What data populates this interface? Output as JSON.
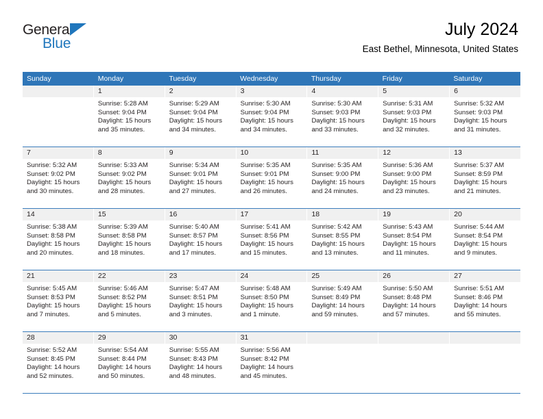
{
  "brand": {
    "name_top": "General",
    "name_bottom": "Blue",
    "accent_color": "#1f76bc"
  },
  "header": {
    "title": "July 2024",
    "subtitle": "East Bethel, Minnesota, United States"
  },
  "theme": {
    "header_row_bg": "#2f76b8",
    "daynum_bg": "#f0f0f0",
    "row_separator": "#3a7cbb"
  },
  "weekdays": [
    "Sunday",
    "Monday",
    "Tuesday",
    "Wednesday",
    "Thursday",
    "Friday",
    "Saturday"
  ],
  "weeks": [
    [
      {
        "day": "",
        "sunrise": "",
        "sunset": "",
        "daylight1": "",
        "daylight2": "",
        "empty": true
      },
      {
        "day": "1",
        "sunrise": "Sunrise: 5:28 AM",
        "sunset": "Sunset: 9:04 PM",
        "daylight1": "Daylight: 15 hours",
        "daylight2": "and 35 minutes."
      },
      {
        "day": "2",
        "sunrise": "Sunrise: 5:29 AM",
        "sunset": "Sunset: 9:04 PM",
        "daylight1": "Daylight: 15 hours",
        "daylight2": "and 34 minutes."
      },
      {
        "day": "3",
        "sunrise": "Sunrise: 5:30 AM",
        "sunset": "Sunset: 9:04 PM",
        "daylight1": "Daylight: 15 hours",
        "daylight2": "and 34 minutes."
      },
      {
        "day": "4",
        "sunrise": "Sunrise: 5:30 AM",
        "sunset": "Sunset: 9:03 PM",
        "daylight1": "Daylight: 15 hours",
        "daylight2": "and 33 minutes."
      },
      {
        "day": "5",
        "sunrise": "Sunrise: 5:31 AM",
        "sunset": "Sunset: 9:03 PM",
        "daylight1": "Daylight: 15 hours",
        "daylight2": "and 32 minutes."
      },
      {
        "day": "6",
        "sunrise": "Sunrise: 5:32 AM",
        "sunset": "Sunset: 9:03 PM",
        "daylight1": "Daylight: 15 hours",
        "daylight2": "and 31 minutes."
      }
    ],
    [
      {
        "day": "7",
        "sunrise": "Sunrise: 5:32 AM",
        "sunset": "Sunset: 9:02 PM",
        "daylight1": "Daylight: 15 hours",
        "daylight2": "and 30 minutes."
      },
      {
        "day": "8",
        "sunrise": "Sunrise: 5:33 AM",
        "sunset": "Sunset: 9:02 PM",
        "daylight1": "Daylight: 15 hours",
        "daylight2": "and 28 minutes."
      },
      {
        "day": "9",
        "sunrise": "Sunrise: 5:34 AM",
        "sunset": "Sunset: 9:01 PM",
        "daylight1": "Daylight: 15 hours",
        "daylight2": "and 27 minutes."
      },
      {
        "day": "10",
        "sunrise": "Sunrise: 5:35 AM",
        "sunset": "Sunset: 9:01 PM",
        "daylight1": "Daylight: 15 hours",
        "daylight2": "and 26 minutes."
      },
      {
        "day": "11",
        "sunrise": "Sunrise: 5:35 AM",
        "sunset": "Sunset: 9:00 PM",
        "daylight1": "Daylight: 15 hours",
        "daylight2": "and 24 minutes."
      },
      {
        "day": "12",
        "sunrise": "Sunrise: 5:36 AM",
        "sunset": "Sunset: 9:00 PM",
        "daylight1": "Daylight: 15 hours",
        "daylight2": "and 23 minutes."
      },
      {
        "day": "13",
        "sunrise": "Sunrise: 5:37 AM",
        "sunset": "Sunset: 8:59 PM",
        "daylight1": "Daylight: 15 hours",
        "daylight2": "and 21 minutes."
      }
    ],
    [
      {
        "day": "14",
        "sunrise": "Sunrise: 5:38 AM",
        "sunset": "Sunset: 8:58 PM",
        "daylight1": "Daylight: 15 hours",
        "daylight2": "and 20 minutes."
      },
      {
        "day": "15",
        "sunrise": "Sunrise: 5:39 AM",
        "sunset": "Sunset: 8:58 PM",
        "daylight1": "Daylight: 15 hours",
        "daylight2": "and 18 minutes."
      },
      {
        "day": "16",
        "sunrise": "Sunrise: 5:40 AM",
        "sunset": "Sunset: 8:57 PM",
        "daylight1": "Daylight: 15 hours",
        "daylight2": "and 17 minutes."
      },
      {
        "day": "17",
        "sunrise": "Sunrise: 5:41 AM",
        "sunset": "Sunset: 8:56 PM",
        "daylight1": "Daylight: 15 hours",
        "daylight2": "and 15 minutes."
      },
      {
        "day": "18",
        "sunrise": "Sunrise: 5:42 AM",
        "sunset": "Sunset: 8:55 PM",
        "daylight1": "Daylight: 15 hours",
        "daylight2": "and 13 minutes."
      },
      {
        "day": "19",
        "sunrise": "Sunrise: 5:43 AM",
        "sunset": "Sunset: 8:54 PM",
        "daylight1": "Daylight: 15 hours",
        "daylight2": "and 11 minutes."
      },
      {
        "day": "20",
        "sunrise": "Sunrise: 5:44 AM",
        "sunset": "Sunset: 8:54 PM",
        "daylight1": "Daylight: 15 hours",
        "daylight2": "and 9 minutes."
      }
    ],
    [
      {
        "day": "21",
        "sunrise": "Sunrise: 5:45 AM",
        "sunset": "Sunset: 8:53 PM",
        "daylight1": "Daylight: 15 hours",
        "daylight2": "and 7 minutes."
      },
      {
        "day": "22",
        "sunrise": "Sunrise: 5:46 AM",
        "sunset": "Sunset: 8:52 PM",
        "daylight1": "Daylight: 15 hours",
        "daylight2": "and 5 minutes."
      },
      {
        "day": "23",
        "sunrise": "Sunrise: 5:47 AM",
        "sunset": "Sunset: 8:51 PM",
        "daylight1": "Daylight: 15 hours",
        "daylight2": "and 3 minutes."
      },
      {
        "day": "24",
        "sunrise": "Sunrise: 5:48 AM",
        "sunset": "Sunset: 8:50 PM",
        "daylight1": "Daylight: 15 hours",
        "daylight2": "and 1 minute."
      },
      {
        "day": "25",
        "sunrise": "Sunrise: 5:49 AM",
        "sunset": "Sunset: 8:49 PM",
        "daylight1": "Daylight: 14 hours",
        "daylight2": "and 59 minutes."
      },
      {
        "day": "26",
        "sunrise": "Sunrise: 5:50 AM",
        "sunset": "Sunset: 8:48 PM",
        "daylight1": "Daylight: 14 hours",
        "daylight2": "and 57 minutes."
      },
      {
        "day": "27",
        "sunrise": "Sunrise: 5:51 AM",
        "sunset": "Sunset: 8:46 PM",
        "daylight1": "Daylight: 14 hours",
        "daylight2": "and 55 minutes."
      }
    ],
    [
      {
        "day": "28",
        "sunrise": "Sunrise: 5:52 AM",
        "sunset": "Sunset: 8:45 PM",
        "daylight1": "Daylight: 14 hours",
        "daylight2": "and 52 minutes."
      },
      {
        "day": "29",
        "sunrise": "Sunrise: 5:54 AM",
        "sunset": "Sunset: 8:44 PM",
        "daylight1": "Daylight: 14 hours",
        "daylight2": "and 50 minutes."
      },
      {
        "day": "30",
        "sunrise": "Sunrise: 5:55 AM",
        "sunset": "Sunset: 8:43 PM",
        "daylight1": "Daylight: 14 hours",
        "daylight2": "and 48 minutes."
      },
      {
        "day": "31",
        "sunrise": "Sunrise: 5:56 AM",
        "sunset": "Sunset: 8:42 PM",
        "daylight1": "Daylight: 14 hours",
        "daylight2": "and 45 minutes."
      },
      {
        "day": "",
        "sunrise": "",
        "sunset": "",
        "daylight1": "",
        "daylight2": "",
        "empty": true
      },
      {
        "day": "",
        "sunrise": "",
        "sunset": "",
        "daylight1": "",
        "daylight2": "",
        "empty": true
      },
      {
        "day": "",
        "sunrise": "",
        "sunset": "",
        "daylight1": "",
        "daylight2": "",
        "empty": true
      }
    ]
  ]
}
